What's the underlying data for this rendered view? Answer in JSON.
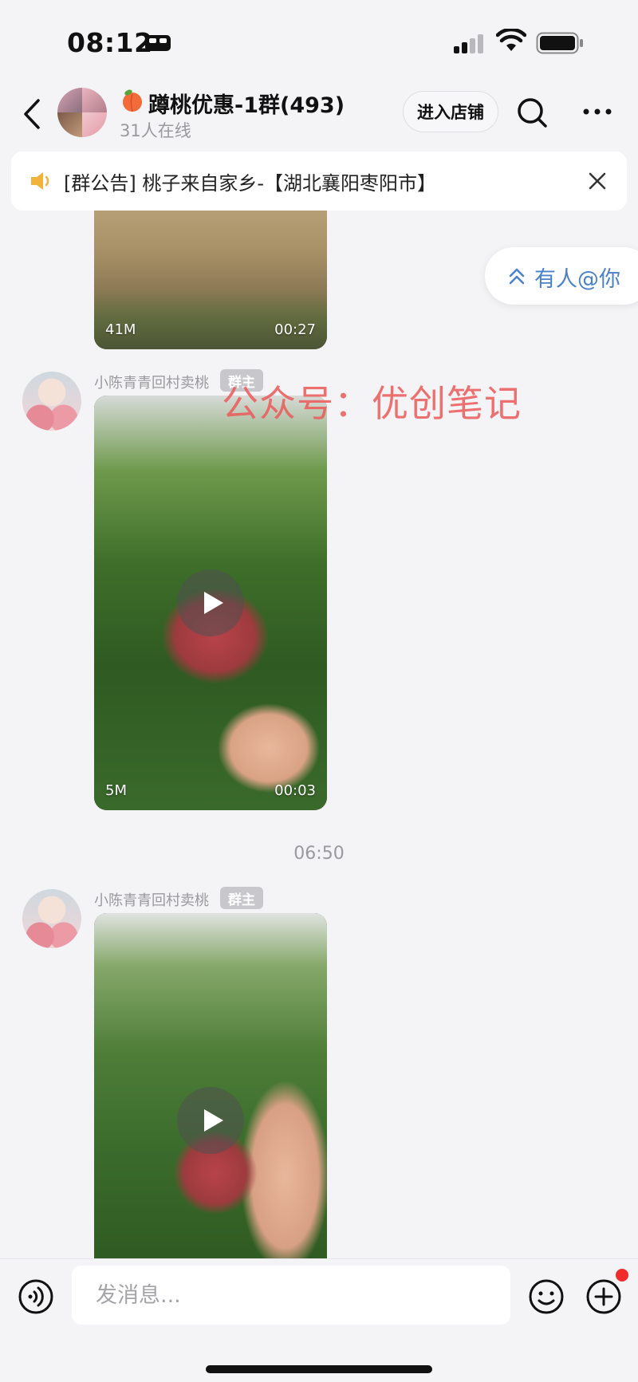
{
  "status_bar": {
    "time": "08:12"
  },
  "header": {
    "group_emoji_icon": "peach",
    "title": "蹲桃优惠-1群(493)",
    "online": "31人在线",
    "enter_shop_label": "进入店铺"
  },
  "announcement": {
    "text": "[群公告] 桃子来自家乡-【湖北襄阳枣阳市】"
  },
  "mention": {
    "label": "有人@你"
  },
  "watermark": "公众号：优创笔记",
  "messages": [
    {
      "size": "41M",
      "duration": "00:27"
    },
    {
      "sender": "小陈青青回村卖桃",
      "badge": "群主",
      "size": "5M",
      "duration": "00:03"
    },
    {
      "sender": "小陈青青回村卖桃",
      "badge": "群主"
    }
  ],
  "timestamp": "06:50",
  "input": {
    "placeholder": "发消息..."
  },
  "colors": {
    "mention_blue": "#4a82c8",
    "notify_red": "#f02c2c",
    "watermark_red": "#ec5a5a"
  }
}
